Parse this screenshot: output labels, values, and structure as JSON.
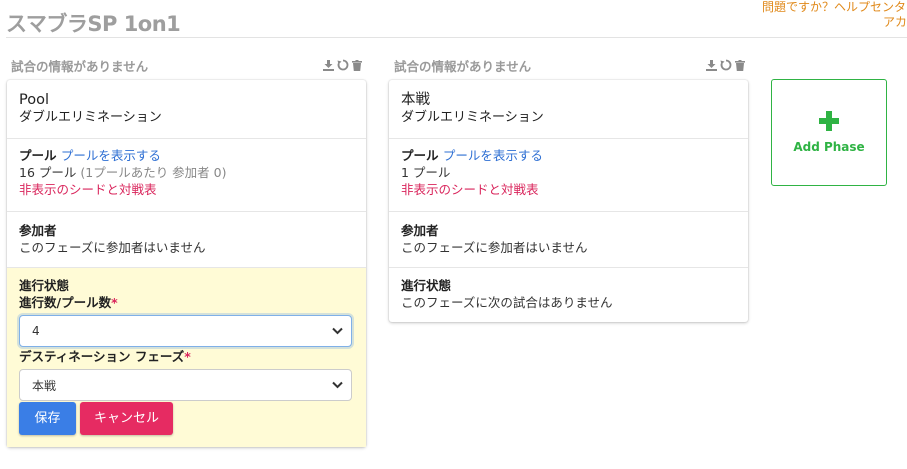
{
  "page": {
    "title": "スマブラSP 1on1"
  },
  "help": {
    "line1": "問題ですか？ヘルプセンター",
    "line2": "アカ"
  },
  "columns": [
    {
      "header": "試合の情報がありません",
      "phase_name": "Pool",
      "phase_type": "ダブルエリミネーション",
      "pool_label": "プール",
      "pool_link": "プールを表示する",
      "pool_count": "16 プール",
      "pool_detail": "(1プールあたり 参加者 0)",
      "hidden_seeds": "非表示のシードと対戦表",
      "entrants_label": "参加者",
      "entrants_text": "このフェーズに参加者はいません",
      "progress": {
        "label": "進行状態",
        "field1_label": "進行数/プール数",
        "field1_value": "4",
        "field2_label": "デスティネーション フェーズ",
        "field2_value": "本戦",
        "required_mark": "*",
        "save": "保存",
        "cancel": "キャンセル"
      }
    },
    {
      "header": "試合の情報がありません",
      "phase_name": "本戦",
      "phase_type": "ダブルエリミネーション",
      "pool_label": "プール",
      "pool_link": "プールを表示する",
      "pool_count": "1 プール",
      "hidden_seeds": "非表示のシードと対戦表",
      "entrants_label": "参加者",
      "entrants_text": "このフェーズに参加者はいません",
      "progress_label": "進行状態",
      "progress_text": "このフェーズに次の試合はありません"
    }
  ],
  "add_phase": {
    "label": "Add Phase"
  },
  "colors": {
    "accent_link": "#2e6fd3",
    "danger": "#e62b62",
    "primary": "#3a7ee6",
    "success": "#2fb344",
    "help": "#e0891a"
  }
}
